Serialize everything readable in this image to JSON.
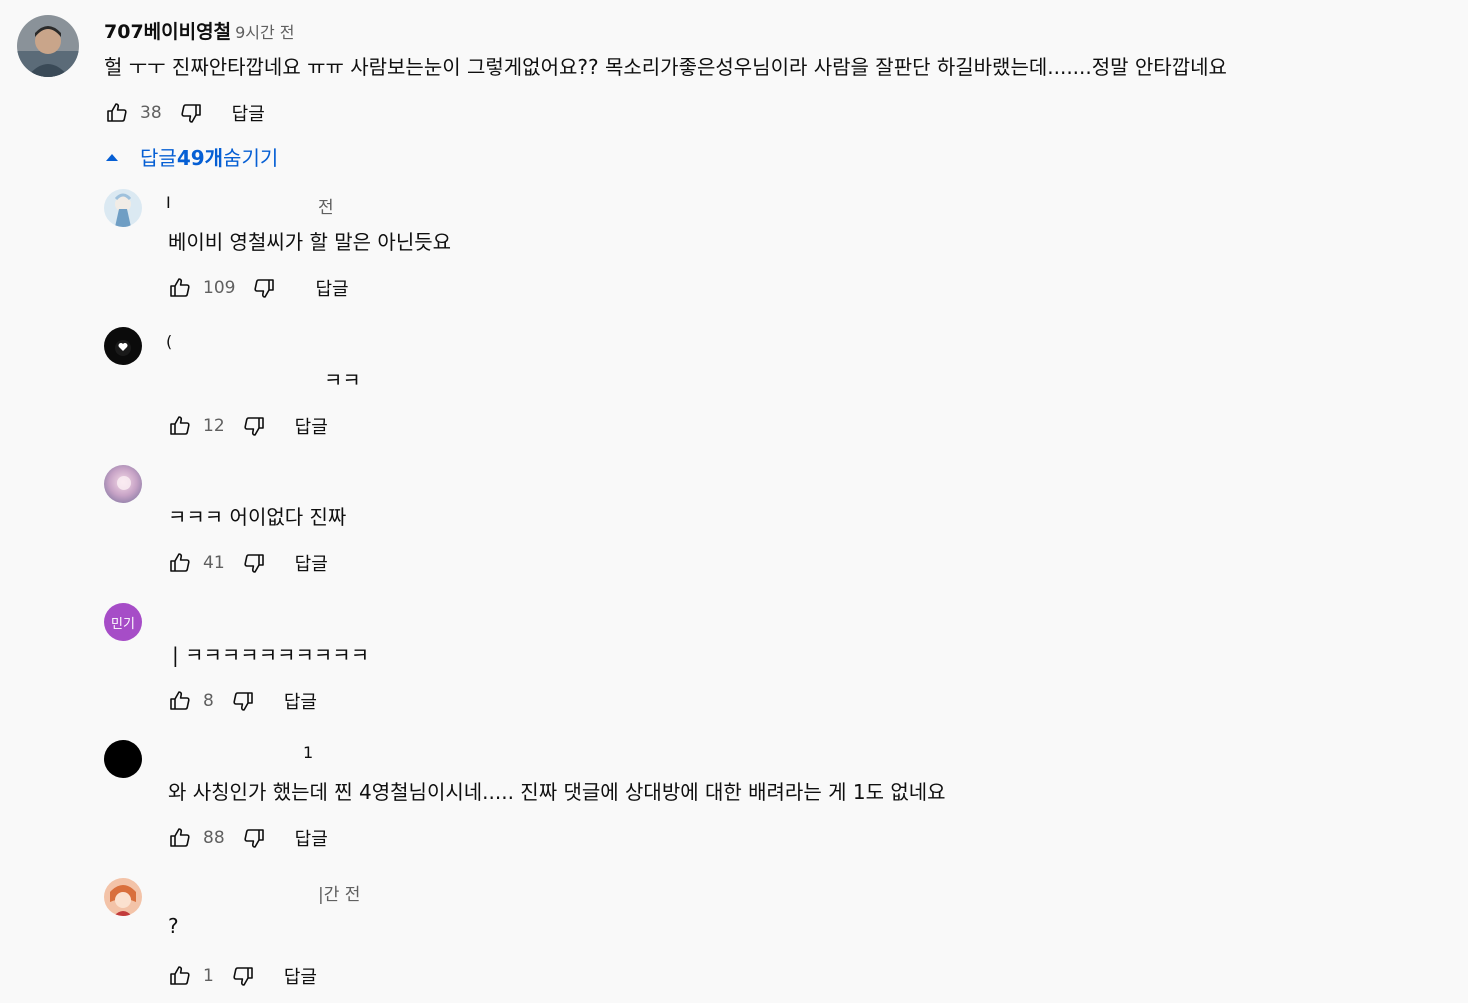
{
  "top_comment": {
    "author": "707베이비영철",
    "time": "9시간 전",
    "text": "헐 ㅜㅜ 진짜안타깝네요 ㅠㅠ 사람보는눈이 그렇게없어요?? 목소리가좋은성우님이라 사람을 잘판단 하길바랬는데.......정말 안타깝네요",
    "likes": "38",
    "reply_label": "답글"
  },
  "replies_toggle": {
    "prefix": "답글 ",
    "count_text": "49개",
    "suffix": " 숨기기"
  },
  "replies": [
    {
      "author_fragment": "I",
      "time_fragment": "전",
      "text": "베이비 영철씨가 할 말은 아닌듯요",
      "likes": "109",
      "reply_label": "답글"
    },
    {
      "author_fragment": "(",
      "time_fragment": "",
      "text": "ㅋㅋ",
      "likes": "12",
      "reply_label": "답글"
    },
    {
      "author_fragment": "",
      "time_fragment": "",
      "text": "ㅋㅋㅋ 어이없다 진짜",
      "likes": "41",
      "reply_label": "답글"
    },
    {
      "author_fragment": "",
      "avatar_text": "민기",
      "time_fragment": "",
      "text": "| ㅋㅋㅋㅋㅋㅋㅋㅋㅋㅋ",
      "likes": "8",
      "reply_label": "답글"
    },
    {
      "author_fragment": "",
      "time_fragment": "1",
      "text": "와 사칭인가 했는데 찐 4영철님이시네..... 진짜 댓글에 상대방에 대한 배려라는 게 1도 없네요",
      "likes": "88",
      "reply_label": "답글"
    },
    {
      "author_fragment": "",
      "time_fragment": "|간 전",
      "text": "?",
      "likes": "1",
      "reply_label": "답글"
    }
  ],
  "colors": {
    "background": "#f9f9f9",
    "link_blue": "#065fd4",
    "secondary_text": "#606060",
    "minki_avatar": "#a64dc7"
  },
  "icons": {
    "like": "thumbs-up-icon",
    "dislike": "thumbs-down-icon",
    "toggle": "caret-up-icon"
  }
}
